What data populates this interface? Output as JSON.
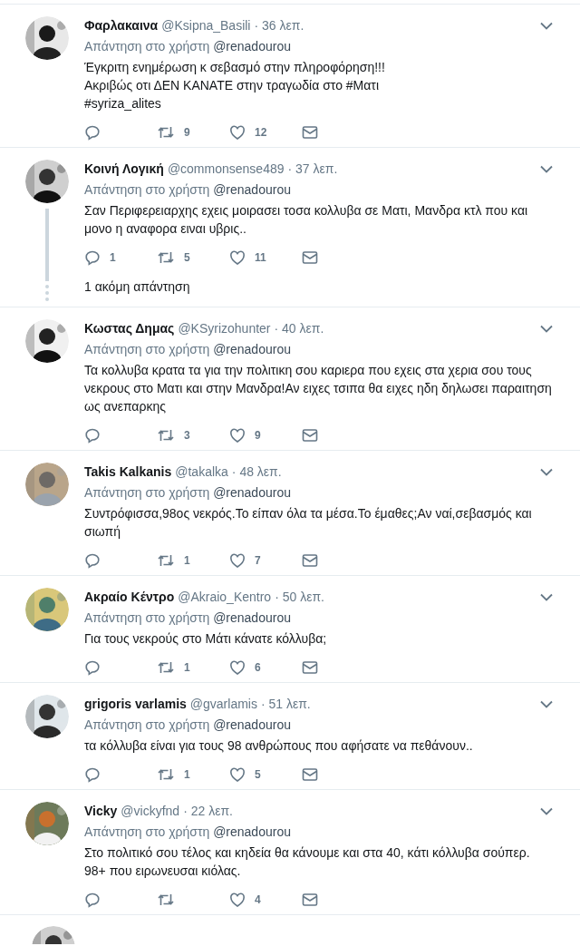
{
  "tweets": [
    {
      "name": "Φαρλακαινα",
      "handle": "@Ksipna_Basili",
      "time": "· 36 λεπ.",
      "reply_prefix": "Απάντηση στο χρήστη",
      "reply_to": "@renadourou",
      "body": "Έγκριτη ενημέρωση κ σεβασμό στην πληροφόρηση!!!\nΑκριβώς οτι ΔΕΝ ΚΑΝΑΤΕ στην τραγωδία στο #Ματι\n#syriza_alites",
      "retweets": "9",
      "likes": "12"
    },
    {
      "name": "Κοινή Λογική",
      "handle": "@commonsense489",
      "time": "· 37 λεπ.",
      "reply_prefix": "Απάντηση στο χρήστη",
      "reply_to": "@renadourou",
      "body": "Σαν Περιφερειαρχης εχεις μοιρασει τοσα κολλυβα σε Ματι, Μανδρα κτλ που και μονο η αναφορα ειναι υβρις..",
      "replies": "1",
      "retweets": "5",
      "likes": "11",
      "more_replies": "1 ακόμη απάντηση"
    },
    {
      "name": "Κωστας Δημας",
      "handle": "@KSyrizohunter",
      "time": "· 40 λεπ.",
      "reply_prefix": "Απάντηση στο χρήστη",
      "reply_to": "@renadourou",
      "body": "Τα κολλυβα κρατα τα για την πολιτικη σου καριερα που εχεις στα χερια σου τους νεκρους στο Ματι και στην Μανδρα!Αν ειχες τσιπα θα ειχες ηδη δηλωσει παραιτηση ως ανεπαρκης",
      "retweets": "3",
      "likes": "9"
    },
    {
      "name": "Takis Kalkanis",
      "handle": "@takalka",
      "time": "· 48 λεπ.",
      "reply_prefix": "Απάντηση στο χρήστη",
      "reply_to": "@renadourou",
      "body": "Συντρόφισσα,98ος νεκρός.Το είπαν όλα τα μέσα.Το έμαθες;Αν ναί,σεβασμός και σιωπή",
      "retweets": "1",
      "likes": "7"
    },
    {
      "name": "Ακραίο Κέντρο",
      "handle": "@Akraio_Kentro",
      "time": "· 50 λεπ.",
      "reply_prefix": "Απάντηση στο χρήστη",
      "reply_to": "@renadourou",
      "body": "Για τους νεκρούς στο Μάτι κάνατε κόλλυβα;",
      "retweets": "1",
      "likes": "6"
    },
    {
      "name": "grigoris varlamis",
      "handle": "@gvarlamis",
      "time": "· 51 λεπ.",
      "reply_prefix": "Απάντηση στο χρήστη",
      "reply_to": "@renadourou",
      "body": "τα κόλλυβα είναι για τους 98 ανθρώπους που αφήσατε να πεθάνουν..",
      "retweets": "1",
      "likes": "5"
    },
    {
      "name": "Vicky",
      "handle": "@vickyfnd",
      "time": "· 22 λεπ.",
      "reply_prefix": "Απάντηση στο χρήστη",
      "reply_to": "@renadourou",
      "body": "Στο πολιτικό σου τέλος και κηδεία θα κάνουμε και στα 40,  κάτι κόλλυβα σούπερ. 98+  που ειρωνευσαι κιόλας.",
      "likes": "4"
    }
  ]
}
